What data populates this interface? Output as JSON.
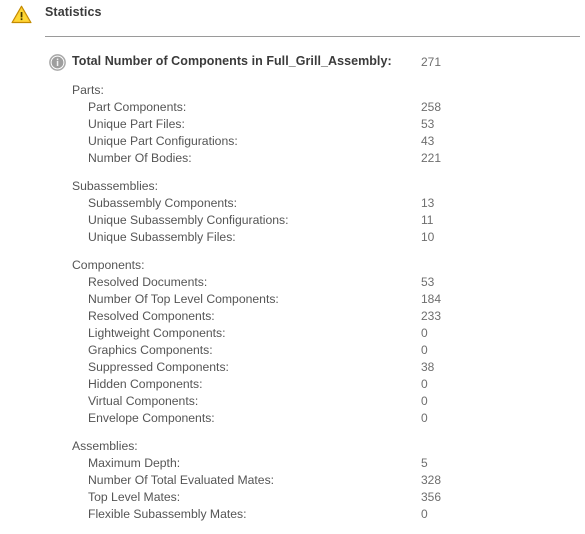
{
  "header": {
    "title": "Statistics",
    "warning_icon": "warning-triangle-icon"
  },
  "total": {
    "icon": "info-circle-icon",
    "label": "Total Number of Components in Full_Grill_Assembly:",
    "value": "271"
  },
  "colors": {
    "text": "#555555",
    "value_text": "#6e6e6e",
    "title_text": "#3b3b3b",
    "warning": "#f2b705",
    "info": "#8c8c8c",
    "divider": "#9a9a9a",
    "background": "#ffffff"
  },
  "groups": [
    {
      "header": "Parts:",
      "rows": [
        {
          "label": "Part Components:",
          "value": "258"
        },
        {
          "label": "Unique Part Files:",
          "value": "53"
        },
        {
          "label": "Unique Part Configurations:",
          "value": "43"
        },
        {
          "label": "Number Of Bodies:",
          "value": "221"
        }
      ]
    },
    {
      "header": "Subassemblies:",
      "rows": [
        {
          "label": "Subassembly Components:",
          "value": "13"
        },
        {
          "label": "Unique Subassembly Configurations:",
          "value": "11"
        },
        {
          "label": "Unique Subassembly Files:",
          "value": "10"
        }
      ]
    },
    {
      "header": "Components:",
      "rows": [
        {
          "label": "Resolved Documents:",
          "value": "53"
        },
        {
          "label": "Number Of Top Level Components:",
          "value": "184"
        },
        {
          "label": "Resolved Components:",
          "value": "233"
        },
        {
          "label": "Lightweight Components:",
          "value": "0"
        },
        {
          "label": "Graphics Components:",
          "value": "0"
        },
        {
          "label": "Suppressed Components:",
          "value": "38"
        },
        {
          "label": "Hidden Components:",
          "value": "0"
        },
        {
          "label": "Virtual Components:",
          "value": "0"
        },
        {
          "label": "Envelope Components:",
          "value": "0"
        }
      ]
    },
    {
      "header": "Assemblies:",
      "rows": [
        {
          "label": "Maximum Depth:",
          "value": "5"
        },
        {
          "label": "Number Of Total Evaluated Mates:",
          "value": "328"
        },
        {
          "label": "Top Level Mates:",
          "value": "356"
        },
        {
          "label": "Flexible Subassembly Mates:",
          "value": "0"
        }
      ]
    }
  ]
}
